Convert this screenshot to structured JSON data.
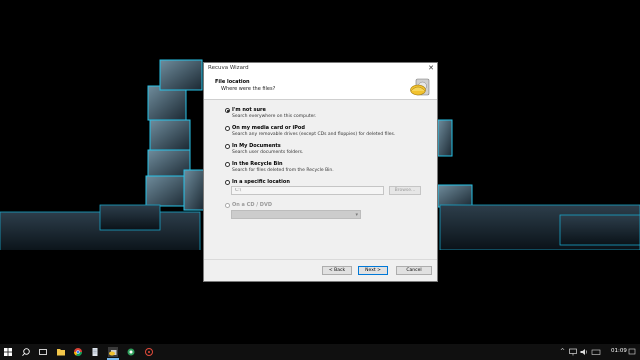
{
  "window": {
    "title": "Recuva Wizard",
    "close_glyph": "✕"
  },
  "header": {
    "title": "File location",
    "subtitle": "Where were the files?",
    "logo_icon": "recuva-hardhat-drive-icon"
  },
  "options": [
    {
      "label": "I'm not sure",
      "description": "Search everywhere on this computer.",
      "checked": true,
      "disabled": false
    },
    {
      "label": "On my media card or iPod",
      "description": "Search any removable drives (except CDs and floppies) for deleted files.",
      "checked": false,
      "disabled": false
    },
    {
      "label": "In My Documents",
      "description": "Search user documents folders.",
      "checked": false,
      "disabled": false
    },
    {
      "label": "In the Recycle Bin",
      "description": "Search for files deleted from the Recycle Bin.",
      "checked": false,
      "disabled": false
    },
    {
      "label": "In a specific location",
      "description": "",
      "checked": false,
      "disabled": false
    },
    {
      "label": "On a CD / DVD",
      "description": "",
      "checked": false,
      "disabled": true
    }
  ],
  "location_input": {
    "value": "C:\\"
  },
  "browse_button": {
    "label": "Browse..."
  },
  "cd_select": {
    "value": ""
  },
  "footer": {
    "back_label": "< Back",
    "next_label": "Next >",
    "cancel_label": "Cancel"
  },
  "taskbar": {
    "time": "01:09",
    "icons": [
      "windows-start-icon",
      "search-icon",
      "task-view-icon",
      "file-explorer-icon",
      "chrome-icon",
      "notepad-icon",
      "recuva-icon",
      "app-icon",
      "media-icon"
    ]
  },
  "colors": {
    "desktop_bg": "#000000",
    "cube_edge": "#27c3e8",
    "accent": "#0078d7"
  }
}
